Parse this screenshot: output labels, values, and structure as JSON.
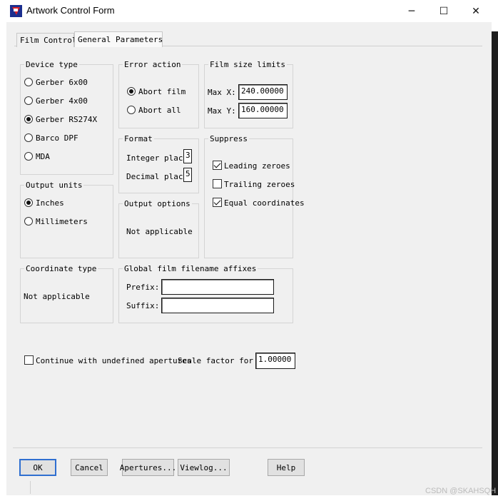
{
  "window": {
    "title": "Artwork Control Form",
    "controls": {
      "minimize": "─",
      "maximize": "☐",
      "close": "✕"
    }
  },
  "tabs": [
    {
      "label": "Film Control",
      "active": false
    },
    {
      "label": "General Parameters",
      "active": true
    }
  ],
  "device_type": {
    "label": "Device type",
    "options": [
      "Gerber 6x00",
      "Gerber 4x00",
      "Gerber RS274X",
      "Barco DPF",
      "MDA"
    ],
    "selected": "Gerber RS274X"
  },
  "error_action": {
    "label": "Error action",
    "options": [
      "Abort film",
      "Abort all"
    ],
    "selected": "Abort film"
  },
  "film_size_limits": {
    "label": "Film size limits",
    "max_x_label": "Max X:",
    "max_x_value": "240.00000",
    "max_y_label": "Max Y:",
    "max_y_value": "160.00000"
  },
  "format": {
    "label": "Format",
    "integer_label": "Integer places",
    "integer_value": "3",
    "decimal_label": "Decimal places",
    "decimal_value": "5"
  },
  "suppress": {
    "label": "Suppress",
    "options": [
      {
        "label": "Leading zeroes",
        "checked": true
      },
      {
        "label": "Trailing zeroes",
        "checked": false
      },
      {
        "label": "Equal coordinates",
        "checked": true
      }
    ]
  },
  "output_units": {
    "label": "Output units",
    "options": [
      "Inches",
      "Millimeters"
    ],
    "selected": "Inches"
  },
  "output_options": {
    "label": "Output options",
    "text": "Not applicable"
  },
  "coordinate_type": {
    "label": "Coordinate type",
    "text": "Not applicable"
  },
  "affixes": {
    "label": "Global film filename affixes",
    "prefix_label": "Prefix:",
    "prefix_value": "",
    "suffix_label": "Suffix:",
    "suffix_value": ""
  },
  "continue_undefined": {
    "label": "Continue with undefined apertures",
    "checked": false
  },
  "scale_factor": {
    "label": "Scale factor for output",
    "value": "1.00000"
  },
  "buttons": {
    "ok": "OK",
    "cancel": "Cancel",
    "apertures": "Apertures...",
    "viewlog": "Viewlog...",
    "help": "Help"
  },
  "watermark": "CSDN @SKAHSQH",
  "colors": {
    "accent": "#2f6fd0",
    "dialog_bg": "#f0f0f0",
    "title_bg": "#ffffff"
  }
}
